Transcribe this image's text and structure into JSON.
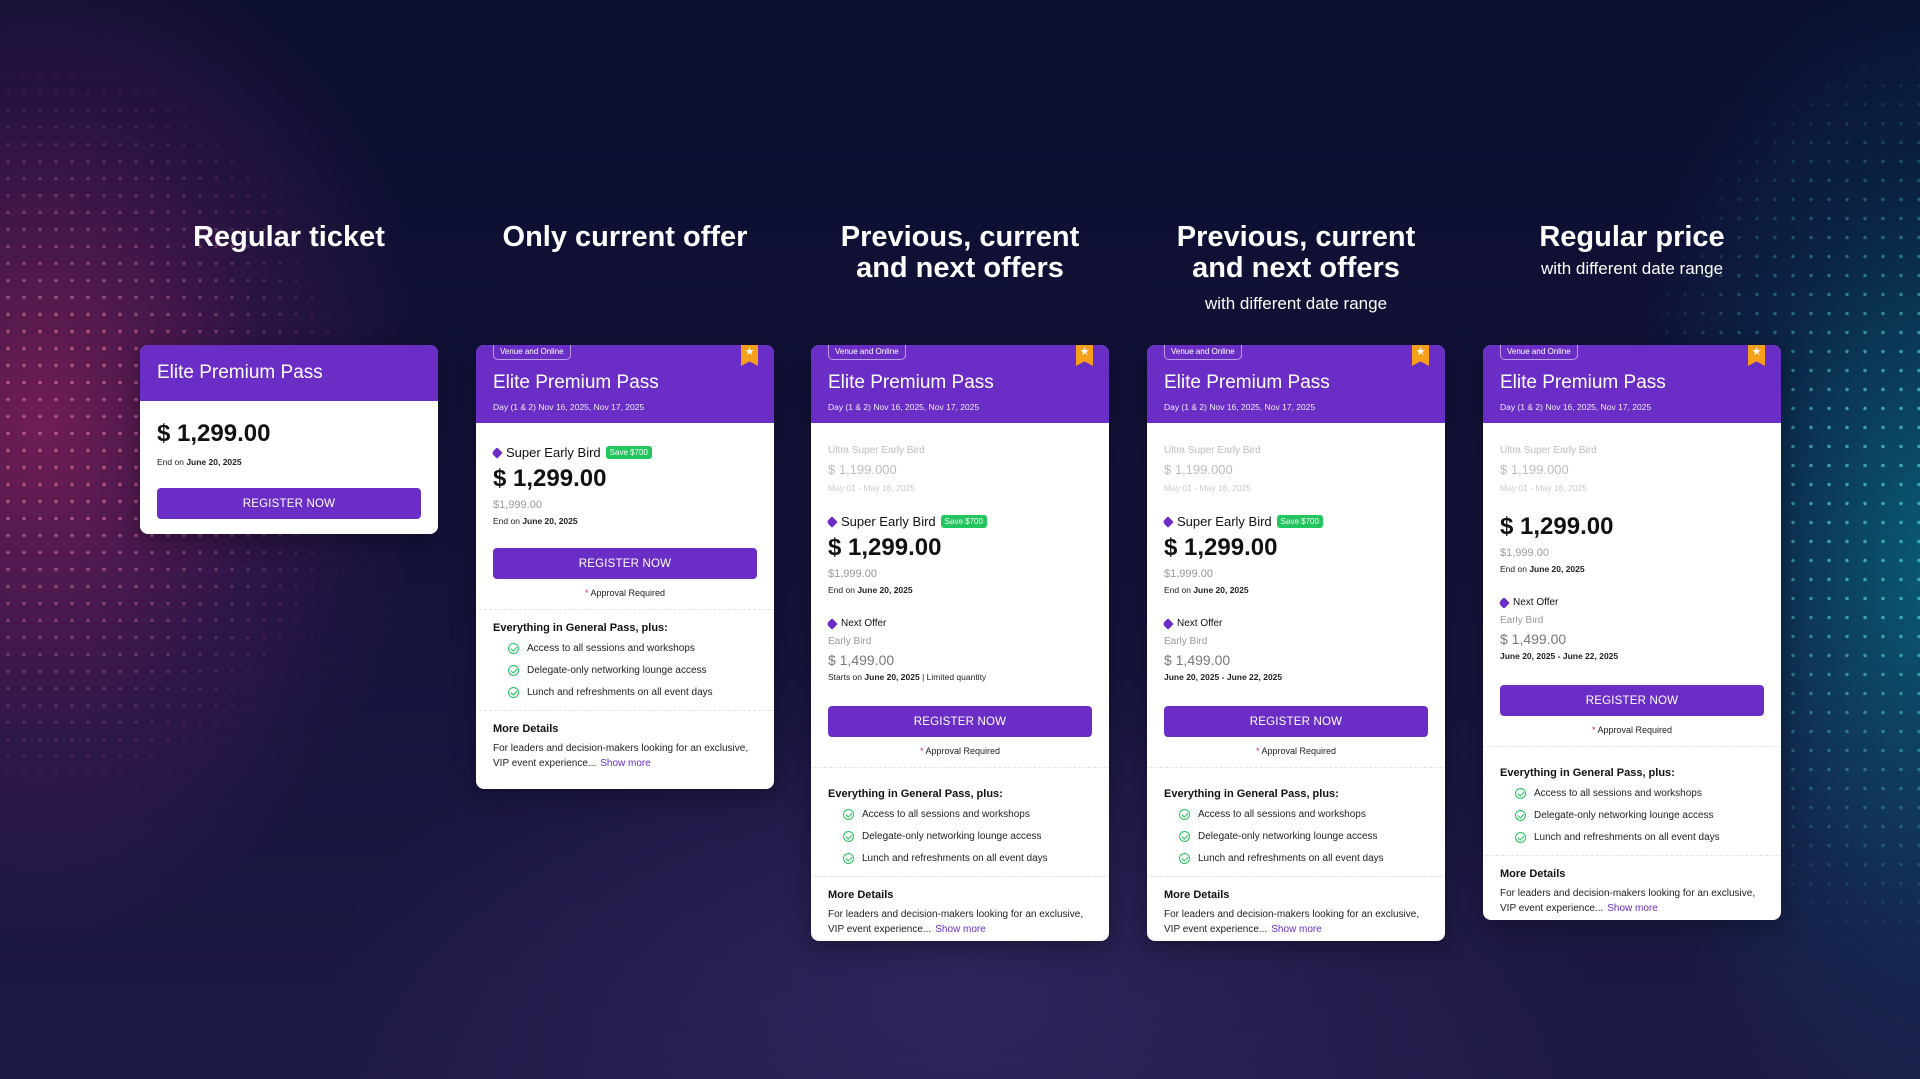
{
  "columns": [
    {
      "heading": "Regular ticket",
      "subheading": "",
      "card": {
        "pass_title": "Elite Premium Pass",
        "price": "$ 1,299.00",
        "end_prefix": "End on",
        "end_date": "June 20, 2025",
        "register": "REGISTER NOW"
      }
    },
    {
      "heading": "Only current offer",
      "subheading": "",
      "card": {
        "venue": "Venue and Online",
        "pass_title": "Elite Premium Pass",
        "date": "Day (1 & 2) Nov 16, 2025, Nov 17, 2025",
        "offer_name": "Super Early Bird",
        "save_badge": "Save $700",
        "price": "$ 1,299.00",
        "original_price": "$1,999.00",
        "end_prefix": "End on",
        "end_date": "June 20, 2025",
        "register": "REGISTER NOW",
        "approval": "Approval Required",
        "features_title": "Everything in General Pass, plus:",
        "features": [
          "Access to all sessions and workshops",
          "Delegate-only networking lounge access",
          "Lunch and refreshments on all event days"
        ],
        "details_title": "More Details",
        "details_text": "For leaders and decision-makers looking for an exclusive, VIP event experience...",
        "show_more": "Show more"
      }
    },
    {
      "heading": "Previous, current and next offers",
      "subheading": "",
      "card": {
        "venue": "Venue and Online",
        "pass_title": "Elite Premium Pass",
        "date": "Day (1 & 2) Nov 16, 2025, Nov 17, 2025",
        "prev_name": "Ultra Super Early Bird",
        "prev_price": "$ 1,199.000",
        "prev_dates": "May 01 - May 18, 2025",
        "offer_name": "Super Early Bird",
        "save_badge": "Save $700",
        "price": "$ 1,299.00",
        "original_price": "$1,999.00",
        "end_prefix": "End on",
        "end_date": "June 20, 2025",
        "next_label": "Next Offer",
        "next_name": "Early Bird",
        "next_price": "$ 1,499.00",
        "next_start_prefix": "Starts on",
        "next_start_date": "June 20, 2025",
        "next_start_suffix": "| Limited quantity",
        "register": "REGISTER NOW",
        "approval": "Approval Required",
        "features_title": "Everything in General Pass, plus:",
        "features": [
          "Access to all sessions and workshops",
          "Delegate-only networking lounge access",
          "Lunch and refreshments on all event days"
        ],
        "details_title": "More Details",
        "details_text": "For leaders and decision-makers looking for an exclusive, VIP event experience...",
        "show_more": "Show more"
      }
    },
    {
      "heading": "Previous, current and next offers",
      "subheading": "with different date range",
      "card": {
        "venue": "Venue and Online",
        "pass_title": "Elite Premium Pass",
        "date": "Day (1 & 2) Nov 16, 2025, Nov 17, 2025",
        "prev_name": "Ultra Super Early Bird",
        "prev_price": "$ 1,199.000",
        "prev_dates": "May 01 - May 18, 2025",
        "offer_name": "Super Early Bird",
        "save_badge": "Save $700",
        "price": "$ 1,299.00",
        "original_price": "$1,999.00",
        "end_prefix": "End on",
        "end_date": "June 20, 2025",
        "next_label": "Next Offer",
        "next_name": "Early Bird",
        "next_price": "$ 1,499.00",
        "next_range": "June 20, 2025 - June 22, 2025",
        "register": "REGISTER NOW",
        "approval": "Approval Required",
        "features_title": "Everything in General Pass, plus:",
        "features": [
          "Access to all sessions and workshops",
          "Delegate-only networking lounge access",
          "Lunch and refreshments on all event days"
        ],
        "details_title": "More Details",
        "details_text": "For leaders and decision-makers looking for an exclusive, VIP event experience...",
        "show_more": "Show more"
      }
    },
    {
      "heading": "Regular price",
      "subheading": "with different date range",
      "card": {
        "venue": "Venue and Online",
        "pass_title": "Elite Premium Pass",
        "date": "Day (1 & 2) Nov 16, 2025, Nov 17, 2025",
        "prev_name": "Ultra Super Early Bird",
        "prev_price": "$ 1,199.000",
        "prev_dates": "May 01 - May 18, 2025",
        "price": "$ 1,299.00",
        "original_price": "$1,999.00",
        "end_prefix": "End on",
        "end_date": "June 20, 2025",
        "next_label": "Next Offer",
        "next_name": "Early Bird",
        "next_price": "$ 1,499.00",
        "next_range": "June 20, 2025 - June 22, 2025",
        "register": "REGISTER NOW",
        "approval": "Approval Required",
        "features_title": "Everything in General Pass, plus:",
        "features": [
          "Access to all sessions and workshops",
          "Delegate-only networking lounge access",
          "Lunch and refreshments on all event days"
        ],
        "details_title": "More Details",
        "details_text": "For leaders and decision-makers looking for an exclusive, VIP event experience...",
        "show_more": "Show more"
      }
    }
  ],
  "colors": {
    "brand_purple": "#6a2ec6",
    "save_green": "#22c55e",
    "ribbon_orange": "#f5a01a",
    "background": "#0b0f2e"
  },
  "icons": {
    "ribbon": "bookmark-star-icon",
    "tag": "tag-icon",
    "check": "check-circle-icon"
  }
}
